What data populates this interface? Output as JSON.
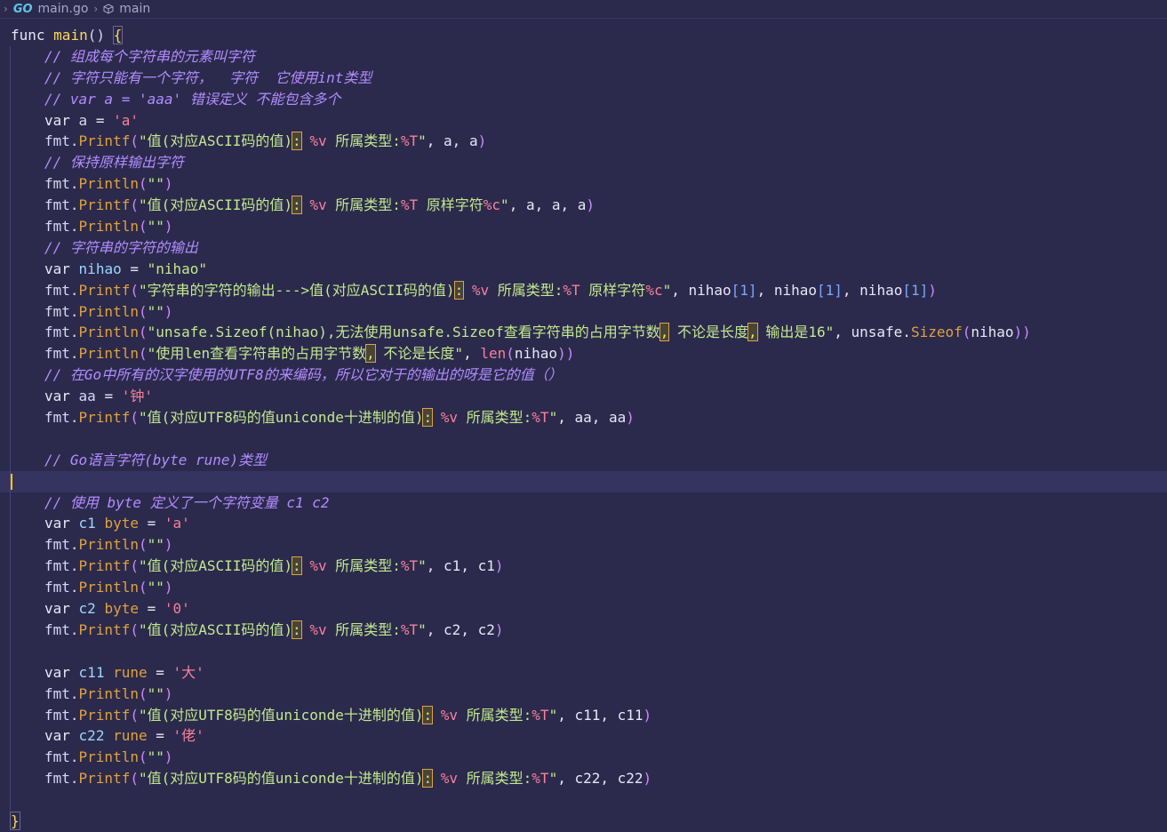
{
  "breadcrumb": {
    "file": "main.go",
    "symbol": "main"
  },
  "code": {
    "header": "func main() {",
    "lines": [
      "// 组成每个字符串的元素叫字符",
      "// 字符只能有一个字符，  字符  它使用int类型",
      "// var a = 'aaa' 错误定义 不能包含多个",
      "var a = 'a'",
      "fmt.Printf(\"值(对应ASCII码的值): %v 所属类型:%T\", a, a)",
      "// 保持原样输出字符",
      "fmt.Println(\"\")",
      "fmt.Printf(\"值(对应ASCII码的值): %v 所属类型:%T 原样字符%c\", a, a, a)",
      "fmt.Println(\"\")",
      "// 字符串的字符的输出",
      "var nihao = \"nihao\"",
      "fmt.Printf(\"字符串的字符的输出--->值(对应ASCII码的值): %v 所属类型:%T 原样字符%c\", nihao[1], nihao[1], nihao[1])",
      "fmt.Println(\"\")",
      "fmt.Println(\"unsafe.Sizeof(nihao),无法使用unsafe.Sizeof查看字符串的占用字节数, 不论是长度, 输出是16\", unsafe.Sizeof(nihao))",
      "fmt.Println(\"使用len查看字符串的占用字节数, 不论是长度\", len(nihao))",
      "// 在Go中所有的汉字使用的UTF8的来编码，所以它对于的输出的呀是它的值（）",
      "var aa = '钟'",
      "fmt.Printf(\"值(对应UTF8码的值uniconde十进制的值): %v 所属类型:%T\", aa, aa)",
      "",
      "// Go语言字符(byte rune)类型",
      "",
      "// 使用 byte 定义了一个字符变量 c1 c2",
      "var c1 byte = 'a'",
      "fmt.Println(\"\")",
      "fmt.Printf(\"值(对应ASCII码的值): %v 所属类型:%T\", c1, c1)",
      "fmt.Println(\"\")",
      "var c2 byte = '0'",
      "fmt.Printf(\"值(对应ASCII码的值): %v 所属类型:%T\", c2, c2)",
      "",
      "var c11 rune = '大'",
      "fmt.Println(\"\")",
      "fmt.Printf(\"值(对应UTF8码的值uniconde十进制的值): %v 所属类型:%T\", c11, c11)",
      "var c22 rune = '佬'",
      "fmt.Println(\"\")",
      "fmt.Printf(\"值(对应UTF8码的值uniconde十进制的值): %v 所属类型:%T\", c22, c22)",
      ""
    ],
    "footer": "}"
  }
}
